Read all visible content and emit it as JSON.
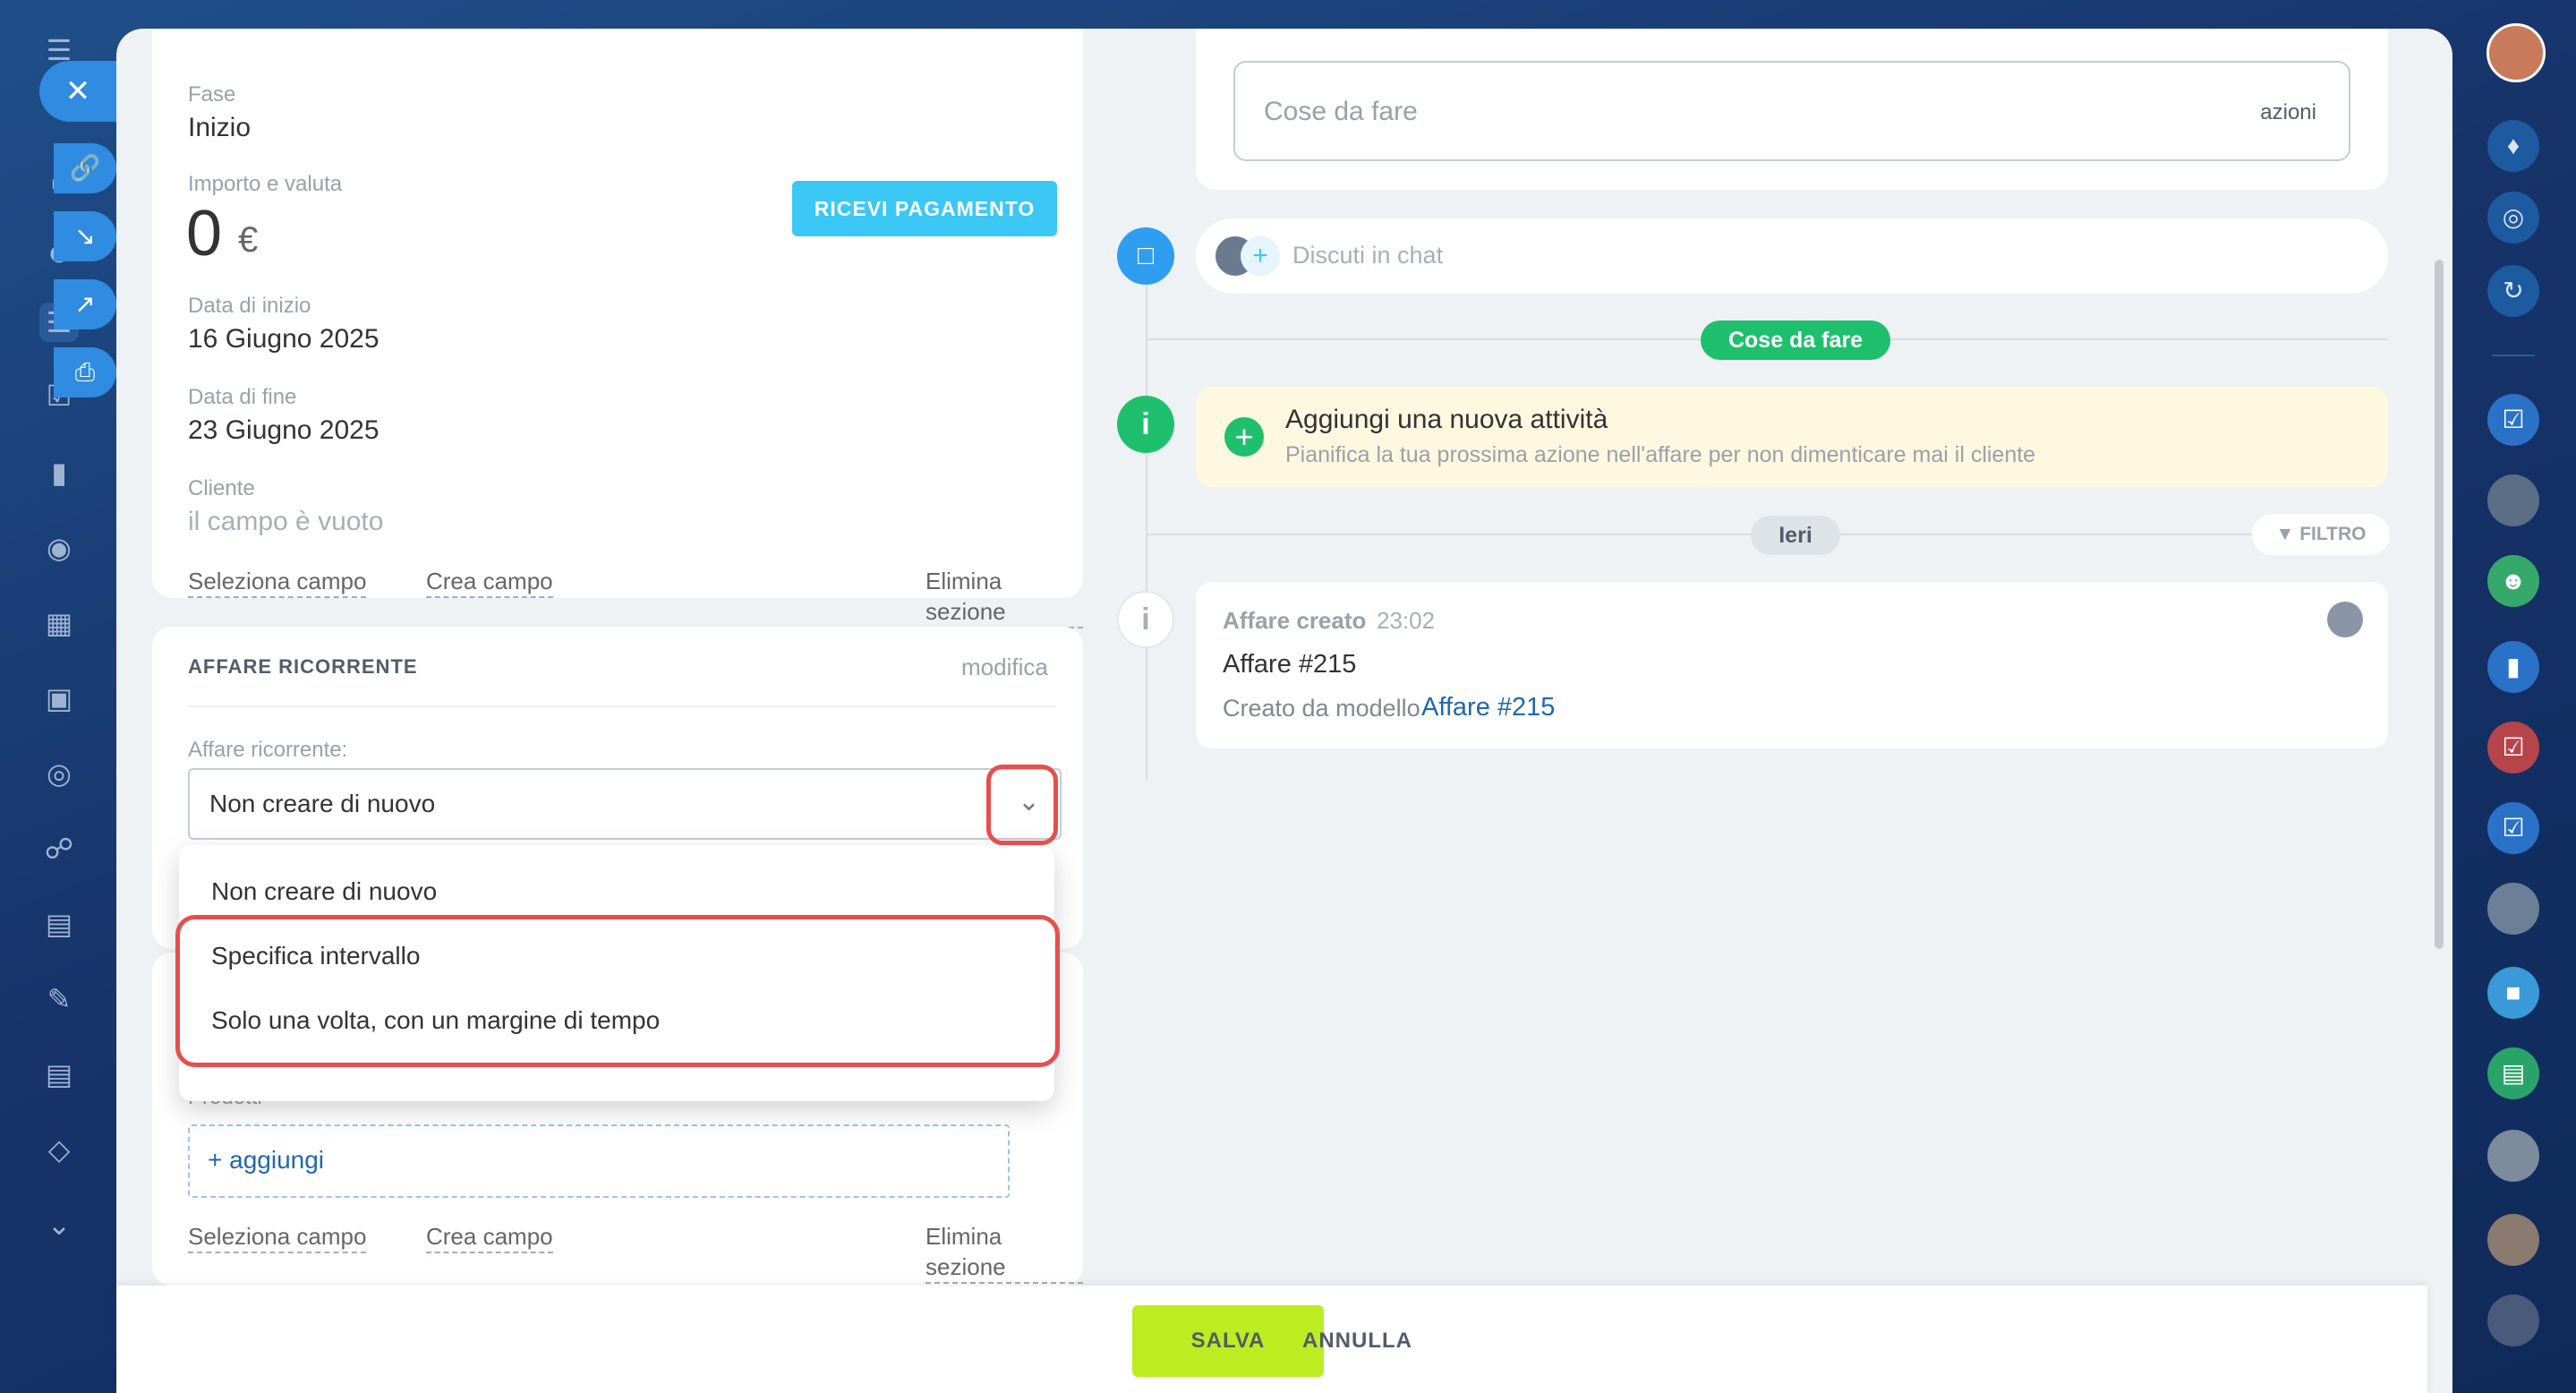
{
  "left_panel": {
    "stage": {
      "label": "Fase",
      "value": "Inizio"
    },
    "amount": {
      "label": "Importo e valuta",
      "value": "0",
      "currency": "€"
    },
    "pay_button": "RICEVI PAGAMENTO",
    "start_date": {
      "label": "Data di inizio",
      "value": "16 Giugno 2025"
    },
    "end_date": {
      "label": "Data di fine",
      "value": "23 Giugno 2025"
    },
    "client": {
      "label": "Cliente",
      "value": "il campo è vuoto"
    },
    "links": {
      "select_field": "Seleziona campo",
      "create_field": "Crea campo",
      "delete_section": "Elimina sezione"
    }
  },
  "recurring": {
    "title": "AFFARE RICORRENTE",
    "edit": "modifica",
    "field_label": "Affare ricorrente:",
    "selected": "Non creare di nuovo",
    "options": [
      "Non creare di nuovo",
      "Specifica intervallo",
      "Solo una volta, con un margine di tempo"
    ]
  },
  "products": {
    "label": "Prodotti",
    "add": "+ aggiungi",
    "links": {
      "select_field": "Seleziona campo",
      "create_field": "Crea campo",
      "delete_section": "Elimina sezione"
    }
  },
  "timeline": {
    "todo_placeholder": "Cose da fare",
    "actions": "azioni",
    "chat_placeholder": "Discuti in chat",
    "todo_pill": "Cose da fare",
    "new_activity_title": "Aggiungi una nuova attività",
    "new_activity_desc": "Pianifica la tua prossima azione nell'affare per non dimenticare mai il cliente",
    "yesterday_pill": "Ieri",
    "filter": "FILTRO",
    "event": {
      "title": "Affare creato",
      "time": "23:02",
      "name": "Affare #215",
      "created_from": "Creato da modello",
      "link": "Affare #215"
    }
  },
  "footer": {
    "save": "SALVA",
    "cancel": "ANNULLA"
  },
  "colors": {
    "accent_blue": "#2f8ce0",
    "pay_button": "#3bc8f5",
    "save_button": "#bbed21",
    "success_green": "#1fc06d",
    "highlight_red": "#e84e4e",
    "notice_yellow": "#fff8e1",
    "link_blue": "#2067b0"
  }
}
